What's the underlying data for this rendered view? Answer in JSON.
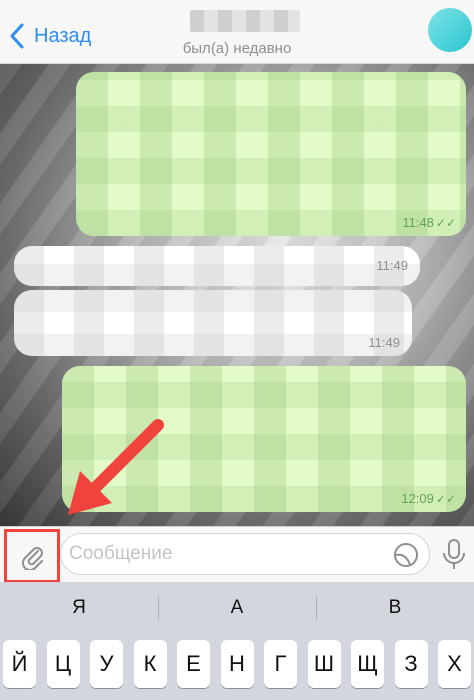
{
  "header": {
    "back_label": "Назад",
    "status": "был(а) недавно"
  },
  "messages": [
    {
      "direction": "outgoing",
      "time": "11:48",
      "read": true
    },
    {
      "direction": "incoming",
      "time": "11:49"
    },
    {
      "direction": "incoming",
      "time": "11:49"
    },
    {
      "direction": "outgoing",
      "time": "12:09",
      "read": true
    }
  ],
  "input": {
    "placeholder": "Сообщение"
  },
  "keyboard": {
    "suggestions": [
      "Я",
      "А",
      "В"
    ],
    "row1": [
      "Й",
      "Ц",
      "У",
      "К",
      "Е",
      "Н",
      "Г",
      "Ш",
      "Щ",
      "З",
      "Х"
    ]
  },
  "colors": {
    "accent": "#2f8cf0",
    "highlight": "#f0433b",
    "outgoing_bubble": "#e2fbc9",
    "incoming_bubble": "#ffffff"
  },
  "icons": {
    "back": "chevron-left-icon",
    "attach": "paperclip-icon",
    "sticker": "sticker-icon",
    "mic": "microphone-icon"
  }
}
